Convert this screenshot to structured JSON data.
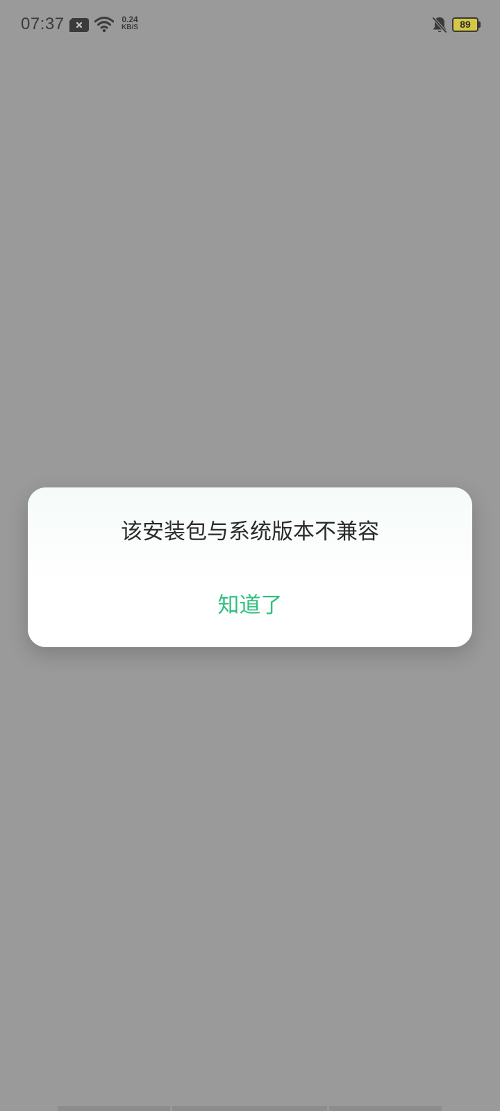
{
  "status_bar": {
    "time": "07:37",
    "net_speed_value": "0.24",
    "net_speed_unit": "KB/S",
    "battery_level": "89",
    "icons": [
      "sim-icon",
      "wifi-icon",
      "bell-off-icon",
      "battery-icon"
    ]
  },
  "dialog": {
    "message": "该安装包与系统版本不兼容",
    "button_label": "知道了"
  },
  "colors": {
    "accent": "#2fbf7f",
    "scrim": "#9a9a9a",
    "battery_fill": "#d6c845"
  }
}
